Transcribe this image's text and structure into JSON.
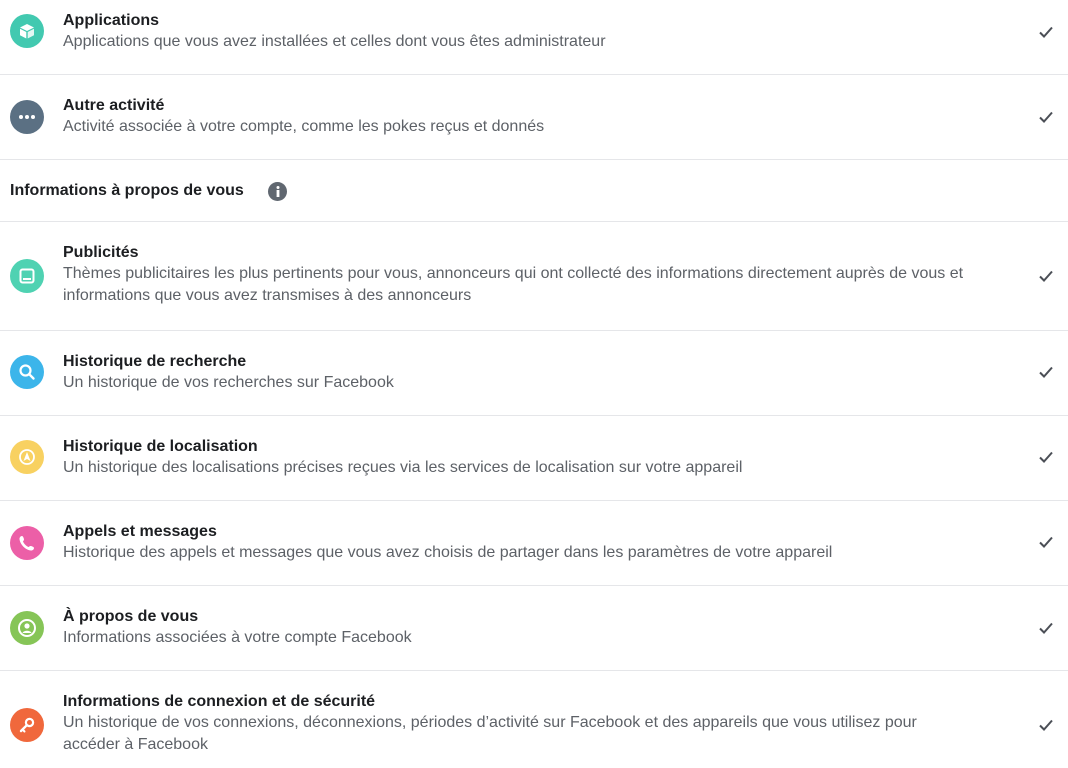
{
  "items_top": [
    {
      "title": "Applications",
      "description": "Applications que vous avez installées et celles dont vous êtes administrateur",
      "icon": "apps-cube-icon",
      "color": "#42c9b0",
      "checked": true
    },
    {
      "title": "Autre activité",
      "description": "Activité associée à votre compte, comme les pokes reçus et donnés",
      "icon": "more-dots-icon",
      "color": "#5b7083",
      "checked": true
    }
  ],
  "section": {
    "title": "Informations à propos de vous",
    "info_icon": "info-icon"
  },
  "items_about": [
    {
      "title": "Publicités",
      "description_line1": "Thèmes publicitaires les plus pertinents pour vous, annonceurs qui ont collecté des informations directement auprès de vous et",
      "description_line2": "informations que vous avez transmises à des annonceurs",
      "icon": "ads-screen-icon",
      "color": "#4fd2b2",
      "checked": true
    },
    {
      "title": "Historique de recherche",
      "description": "Un historique de vos recherches sur Facebook",
      "icon": "search-icon",
      "color": "#3cb5ea",
      "checked": true
    },
    {
      "title": "Historique de localisation",
      "description": "Un historique des localisations précises reçues via les services de localisation sur votre appareil",
      "icon": "location-icon",
      "color": "#f8d161",
      "checked": true
    },
    {
      "title": "Appels et messages",
      "description": "Historique des appels et messages que vous avez choisis de partager dans les paramètres de votre appareil",
      "icon": "phone-icon",
      "color": "#ec5fa7",
      "checked": true
    },
    {
      "title": "À propos de vous",
      "description": "Informations associées à votre compte Facebook",
      "icon": "profile-icon",
      "color": "#86c557",
      "checked": true
    },
    {
      "title": "Informations de connexion et de sécurité",
      "description_line1": "Un historique de vos connexions, déconnexions, périodes d’activité sur Facebook et des appareils que vous utilisez pour",
      "description_line2": "accéder à Facebook",
      "icon": "key-icon",
      "color": "#f0683c",
      "checked": true
    }
  ]
}
